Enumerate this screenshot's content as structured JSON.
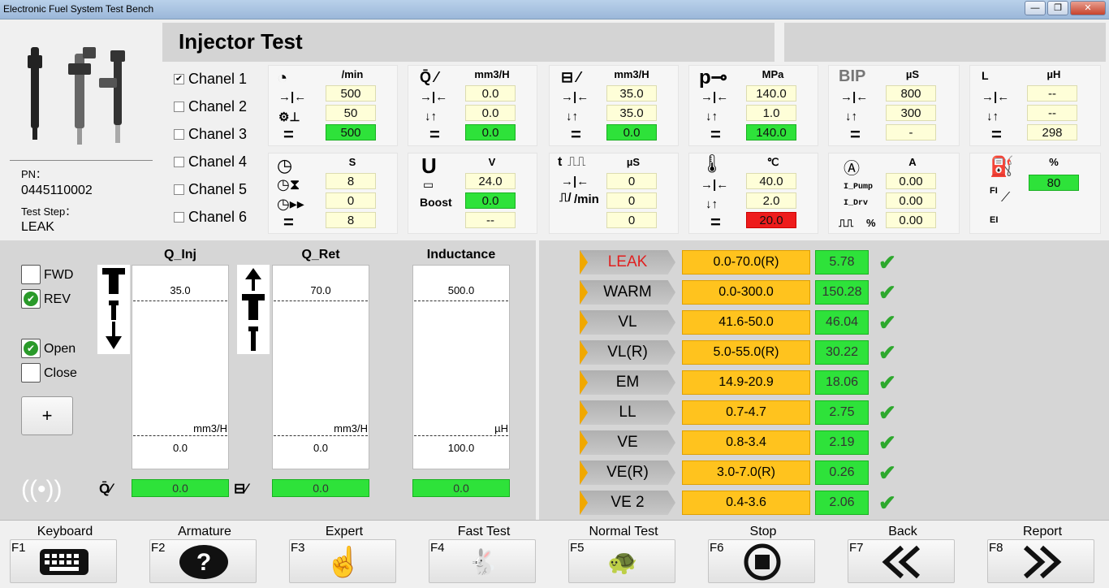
{
  "window": {
    "title": "Electronic Fuel System Test Bench",
    "minimize": "—",
    "maximize": "❐",
    "close": "✕"
  },
  "header": {
    "title": "Injector Test"
  },
  "info": {
    "pn_label": "PN：",
    "pn_value": "0445110002",
    "step_label": "Test Step：",
    "step_value": "LEAK"
  },
  "channels": [
    {
      "label": "Chanel 1",
      "checked": true
    },
    {
      "label": "Chanel 2",
      "checked": false
    },
    {
      "label": "Chanel 3",
      "checked": false
    },
    {
      "label": "Chanel 4",
      "checked": false
    },
    {
      "label": "Chanel 5",
      "checked": false
    },
    {
      "label": "Chanel 6",
      "checked": false
    }
  ],
  "params": {
    "speed": {
      "unit": "/min",
      "set": "500",
      "tol": "50",
      "actual": "500"
    },
    "flow": {
      "unit": "mm3/H",
      "set": "0.0",
      "tol": "0.0",
      "actual": "0.0"
    },
    "return_flow": {
      "unit": "mm3/H",
      "set": "35.0",
      "tol": "35.0",
      "actual": "0.0"
    },
    "pressure": {
      "unit": "MPa",
      "set": "140.0",
      "tol": "1.0",
      "actual": "140.0"
    },
    "bip": {
      "label": "BIP",
      "unit": "µS",
      "set": "800",
      "tol": "300",
      "actual": "-"
    },
    "inductance": {
      "label": "L",
      "unit": "µH",
      "set": "--",
      "tol": "--",
      "actual": "298"
    },
    "time": {
      "unit": "S",
      "set": "8",
      "remaining": "0",
      "total": "8"
    },
    "voltage": {
      "unit": "V",
      "set": "24.0",
      "boost_label": "Boost",
      "boost": "0.0",
      "actual": "--"
    },
    "pulse": {
      "label": "t",
      "unit": "µS",
      "set": "0",
      "freq_label": "/min",
      "freq": "0",
      "actual": "0"
    },
    "temp": {
      "unit": "℃",
      "set": "40.0",
      "tol": "2.0",
      "actual": "20.0"
    },
    "current": {
      "unit": "A",
      "pump_label": "I_Pump",
      "pump": "0.00",
      "drv_label": "I_Drv",
      "drv": "0.00",
      "duty_label": "%",
      "duty": "0.00"
    },
    "fuel": {
      "unit": "%",
      "value": "80",
      "f1": "FI",
      "e1": "EI"
    }
  },
  "mode": {
    "fwd": "FWD",
    "rev": "REV",
    "open": "Open",
    "close": "Close",
    "fwd_on": false,
    "rev_on": true,
    "open_on": true,
    "close_on": false,
    "plus": "+"
  },
  "gauges": [
    {
      "title": "Q_Inj",
      "max": "35.0",
      "unit": "mm3/H",
      "min": "0.0",
      "value": "0.0"
    },
    {
      "title": "Q_Ret",
      "max": "70.0",
      "unit": "mm3/H",
      "min": "0.0",
      "value": "0.0"
    },
    {
      "title": "Inductance",
      "max": "500.0",
      "unit": "µH",
      "min": "100.0",
      "value": "0.0"
    }
  ],
  "steps": [
    {
      "name": "LEAK",
      "range": "0.0-70.0(R)",
      "result": "5.78",
      "active": true
    },
    {
      "name": "WARM",
      "range": "0.0-300.0",
      "result": "150.28",
      "active": false
    },
    {
      "name": "VL",
      "range": "41.6-50.0",
      "result": "46.04",
      "active": false
    },
    {
      "name": "VL(R)",
      "range": "5.0-55.0(R)",
      "result": "30.22",
      "active": false
    },
    {
      "name": "EM",
      "range": "14.9-20.9",
      "result": "18.06",
      "active": false
    },
    {
      "name": "LL",
      "range": "0.7-4.7",
      "result": "2.75",
      "active": false
    },
    {
      "name": "VE",
      "range": "0.8-3.4",
      "result": "2.19",
      "active": false
    },
    {
      "name": "VE(R)",
      "range": "3.0-7.0(R)",
      "result": "0.26",
      "active": false
    },
    {
      "name": "VE 2",
      "range": "0.4-3.6",
      "result": "2.06",
      "active": false
    }
  ],
  "fkeys": [
    {
      "key": "F1",
      "label": "Keyboard",
      "icon": "keyboard-icon"
    },
    {
      "key": "F2",
      "label": "Armature",
      "icon": "question-icon"
    },
    {
      "key": "F3",
      "label": "Expert",
      "icon": "hand-icon"
    },
    {
      "key": "F4",
      "label": "Fast Test",
      "icon": "rabbit-icon"
    },
    {
      "key": "F5",
      "label": "Normal Test",
      "icon": "turtle-icon"
    },
    {
      "key": "F6",
      "label": "Stop",
      "icon": "stop-icon"
    },
    {
      "key": "F7",
      "label": "Back",
      "icon": "back-icon"
    },
    {
      "key": "F8",
      "label": "Report",
      "icon": "forward-icon"
    }
  ],
  "colors": {
    "ok_green": "#2ee23a",
    "alarm_red": "#ee1c1c",
    "range_amber": "#ffc31e",
    "active_step_red": "#e02020"
  }
}
